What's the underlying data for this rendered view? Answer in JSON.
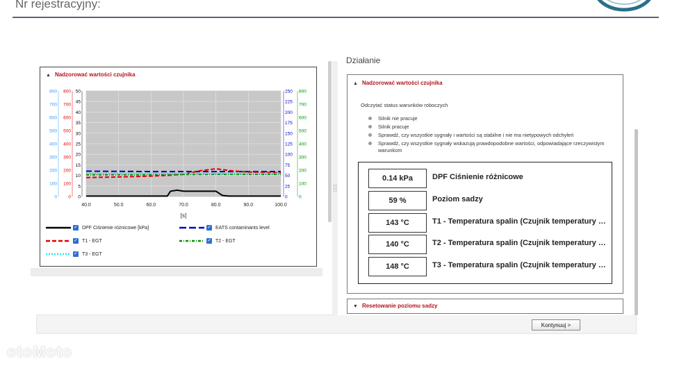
{
  "header": {
    "title": "Nr rejestracyjny:"
  },
  "left_panel": {
    "section_title": "Nadzorować wartości czujnika",
    "chart_legend": [
      {
        "label": "DPF Ciśnienie różnicowe [kPa]",
        "color": "#000000"
      },
      {
        "label": "EATS contaminants level",
        "color": "#0000cc"
      },
      {
        "label": "T1 - EGT",
        "color": "#e00000"
      },
      {
        "label": "T2 - EGT",
        "color": "#009000"
      },
      {
        "label": "T3 - EGT",
        "color": "#33ddee"
      }
    ]
  },
  "chart_data": {
    "type": "line",
    "xlabel": "[s]",
    "x_ticks": [
      "40.0",
      "50.0",
      "60.0",
      "70.0",
      "80.0",
      "90.0",
      "100.0"
    ],
    "xlim": [
      40,
      100
    ],
    "axes_left": [
      {
        "color": "#3399ff",
        "ticks": [
          "800",
          "700",
          "600",
          "500",
          "400",
          "300",
          "200",
          "100",
          "0"
        ]
      },
      {
        "color": "#e00000",
        "ticks": [
          "800",
          "700",
          "600",
          "500",
          "400",
          "300",
          "200",
          "100",
          "0"
        ]
      },
      {
        "color": "#000000",
        "ticks": [
          "50",
          "45",
          "40",
          "35",
          "30",
          "25",
          "20",
          "15",
          "10",
          "5",
          "0"
        ]
      }
    ],
    "axes_right": [
      {
        "color": "#0000cc",
        "ticks": [
          "250",
          "225",
          "200",
          "175",
          "150",
          "125",
          "100",
          "75",
          "50",
          "25",
          "0"
        ]
      },
      {
        "color": "#009000",
        "ticks": [
          "800",
          "700",
          "600",
          "500",
          "400",
          "300",
          "200",
          "100",
          "0"
        ]
      }
    ],
    "grid": true,
    "series": [
      {
        "name": "DPF Ciśnienie różnicowe [kPa]",
        "color": "#000000",
        "dash": "none",
        "ymax": 50,
        "x": [
          40,
          50,
          60,
          65,
          66,
          68,
          70,
          75,
          80,
          82,
          84,
          90,
          100
        ],
        "y": [
          0.2,
          0.2,
          0.2,
          0.2,
          2.5,
          3.0,
          2.5,
          2.5,
          2.5,
          0.5,
          0.2,
          0.2,
          0.2
        ]
      },
      {
        "name": "EATS contaminants level",
        "color": "#0000cc",
        "dash": "8,4",
        "ymax": 250,
        "x": [
          40,
          60,
          80,
          100
        ],
        "y": [
          60,
          59,
          59,
          59
        ]
      },
      {
        "name": "T1 - EGT",
        "color": "#e00000",
        "dash": "6,3",
        "ymax": 800,
        "x": [
          40,
          45,
          50,
          60,
          65,
          70,
          75,
          80,
          85,
          90,
          100
        ],
        "y": [
          143,
          146,
          148,
          155,
          160,
          168,
          195,
          210,
          195,
          185,
          180
        ]
      },
      {
        "name": "T2 - EGT",
        "color": "#009000",
        "dash": "4,2,1,2",
        "ymax": 800,
        "x": [
          40,
          60,
          80,
          100
        ],
        "y": [
          165,
          165,
          168,
          168
        ]
      },
      {
        "name": "T3 - EGT",
        "color": "#33ddee",
        "dash": "2,2",
        "ymax": 800,
        "x": [
          40,
          60,
          80,
          100
        ],
        "y": [
          175,
          174,
          175,
          175
        ]
      }
    ]
  },
  "right_panel": {
    "heading": "Działanie",
    "section_title": "Nadzorować wartości czujnika",
    "intro": "Odczytać status warunków roboczych",
    "status_items": [
      "Silnik nie pracuje",
      "Silnik pracuje",
      "Sprawdź, czy wszystkie sygnały i wartości są stabilne i nie ma nietypowych odchyleń",
      "Sprawdź, czy wszystkie sygnały wskazują prawdopodobne wartości, odpowiadające rzeczywistym warunkom"
    ],
    "values": [
      {
        "value": "0.14 kPa",
        "label": "DPF Ciśnienie różnicowe"
      },
      {
        "value": "59 %",
        "label": "Poziom sadzy"
      },
      {
        "value": "143 °C",
        "label": "T1 - Temperatura spalin (Czujnik temperatury s..."
      },
      {
        "value": "140 °C",
        "label": "T2 - Temperatura spalin (Czujnik temperatury n..."
      },
      {
        "value": "148 °C",
        "label": "T3 - Temperatura spalin (Czujnik temperatury n..."
      }
    ],
    "reset_title": "Resetowanie poziomu sadzy"
  },
  "footer": {
    "continue_label": "Kontynuuj >"
  },
  "watermark": "otoMoto"
}
